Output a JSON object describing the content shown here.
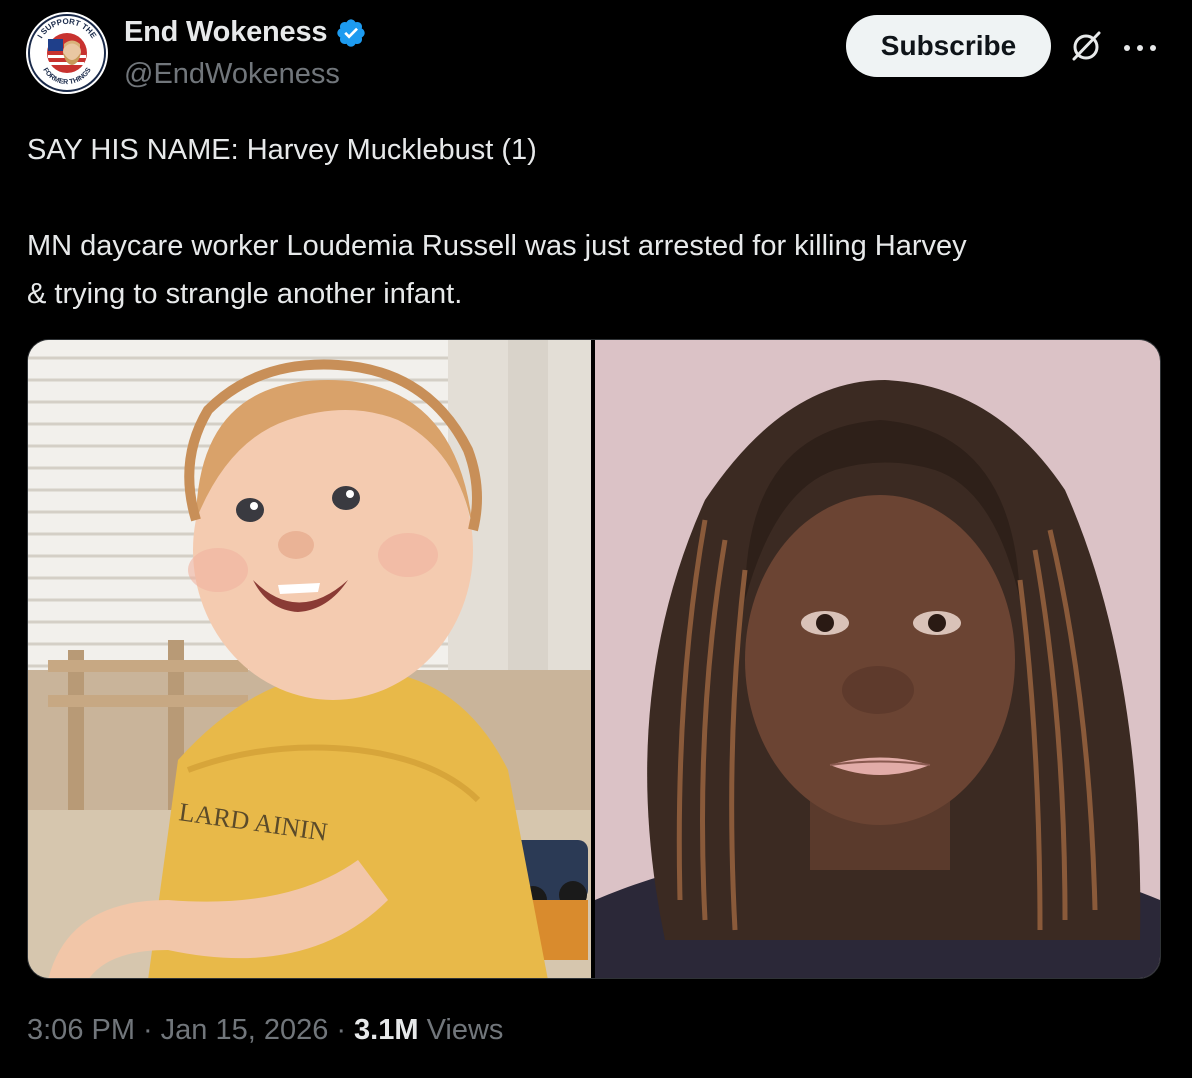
{
  "author": {
    "display_name": "End Wokeness",
    "handle": "@EndWokeness",
    "verified": true,
    "avatar_icon": "badge-logo",
    "avatar_text_top": "I SUPPORT THE",
    "avatar_text_bottom": "FORMER THINGS"
  },
  "actions": {
    "subscribe_label": "Subscribe",
    "grok_icon": "grok-icon",
    "more_icon": "more-dots-icon"
  },
  "tweet": {
    "line1": "SAY HIS NAME: Harvey Mucklebust (1)",
    "line2": "MN daycare worker Loudemia Russell was just arrested for killing Harvey",
    "line3": "& trying to strangle another infant."
  },
  "media": {
    "left_shirt_text": "LARD AININ"
  },
  "meta": {
    "time": "3:06 PM",
    "date": "Jan 15, 2026",
    "views_count": "3.1M",
    "views_label": "Views",
    "separator": "·"
  },
  "colors": {
    "background": "#000000",
    "primary_text": "#e7e9ea",
    "secondary_text": "#71767b",
    "verified_blue": "#1d9bf0",
    "subscribe_bg": "#eff3f4"
  }
}
